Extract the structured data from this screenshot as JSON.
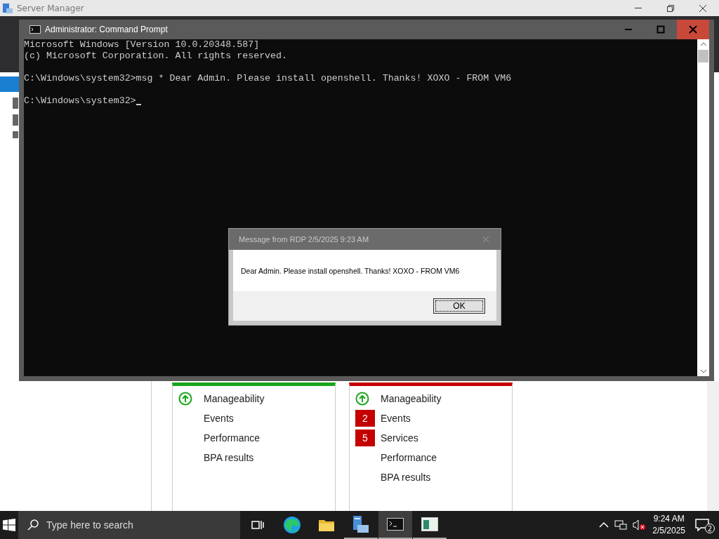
{
  "server_manager": {
    "title": "Server Manager",
    "tiles": [
      {
        "color": "#1aa41a",
        "rows": [
          {
            "kind": "status",
            "label": "Manageability"
          },
          {
            "kind": "plain",
            "label": "Events"
          },
          {
            "kind": "plain",
            "label": "Performance"
          },
          {
            "kind": "plain",
            "label": "BPA results"
          }
        ]
      },
      {
        "color": "#c40000",
        "rows": [
          {
            "kind": "status",
            "label": "Manageability"
          },
          {
            "kind": "count",
            "count": "2",
            "label": "Events"
          },
          {
            "kind": "count",
            "count": "5",
            "label": "Services"
          },
          {
            "kind": "plain",
            "label": "Performance"
          },
          {
            "kind": "plain",
            "label": "BPA results"
          }
        ]
      }
    ]
  },
  "cmd": {
    "title": "Administrator: Command Prompt",
    "blocks": [
      [
        "Microsoft Windows [Version 10.0.20348.587]",
        "(c) Microsoft Corporation. All rights reserved."
      ],
      [
        "C:\\Windows\\system32>msg * Dear Admin. Please install openshell. Thanks! XOXO - FROM VM6"
      ],
      [
        "C:\\Windows\\system32>"
      ]
    ]
  },
  "message_box": {
    "title": "Message from RDP 2/5/2025 9:23 AM",
    "text": "Dear Admin. Please install openshell. Thanks! XOXO - FROM VM6",
    "button": "OK"
  },
  "taskbar": {
    "search": {
      "placeholder": "Type here to search"
    },
    "apps": [
      {
        "kind": "taskview",
        "running": false,
        "selected": false
      },
      {
        "kind": "edge",
        "running": false,
        "selected": false
      },
      {
        "kind": "explorer",
        "running": false,
        "selected": false
      },
      {
        "kind": "servermanager",
        "running": true,
        "selected": false
      },
      {
        "kind": "cmd",
        "running": true,
        "selected": true
      },
      {
        "kind": "window",
        "running": true,
        "selected": false
      }
    ],
    "time": "9:24 AM",
    "date": "2/5/2025",
    "notifications": "2"
  }
}
